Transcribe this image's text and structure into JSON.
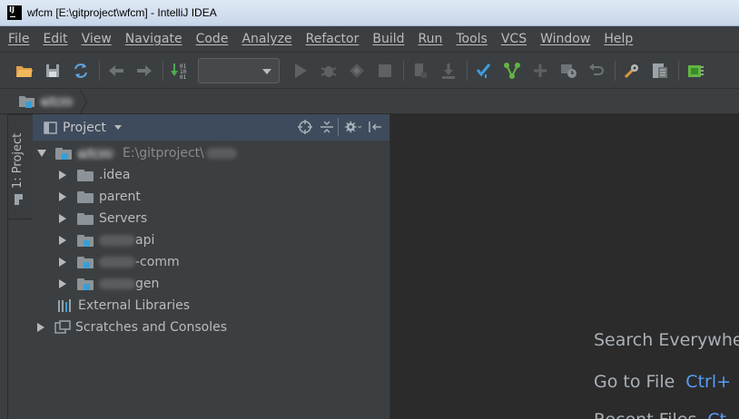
{
  "window": {
    "title": "wfcm [E:\\gitproject\\wfcm] - IntelliJ IDEA"
  },
  "menu": {
    "items": [
      "File",
      "Edit",
      "View",
      "Navigate",
      "Code",
      "Analyze",
      "Refactor",
      "Build",
      "Run",
      "Tools",
      "VCS",
      "Window",
      "Help"
    ]
  },
  "navbar": {
    "crumb": "wfcm"
  },
  "side_tab": {
    "label": "1: Project"
  },
  "project_panel": {
    "title": "Project",
    "root": {
      "name": "wfcm",
      "path": "E:\\gitproject\\"
    },
    "children": [
      {
        "label": ".idea"
      },
      {
        "label": "parent"
      },
      {
        "label": "Servers"
      },
      {
        "label": "api"
      },
      {
        "label": "-comm"
      },
      {
        "label": "gen"
      }
    ],
    "external_libraries": "External Libraries",
    "scratches": "Scratches and Consoles"
  },
  "editor_hints": [
    {
      "label": "Search Everywhere",
      "shortcut": ""
    },
    {
      "label": "Go to File",
      "shortcut": "Ctrl+"
    },
    {
      "label": "Recent Files",
      "shortcut": "Ct"
    }
  ],
  "colors": {
    "accent": "#589df6",
    "panel_header": "#3d4b5c",
    "background": "#2b2b2b"
  }
}
